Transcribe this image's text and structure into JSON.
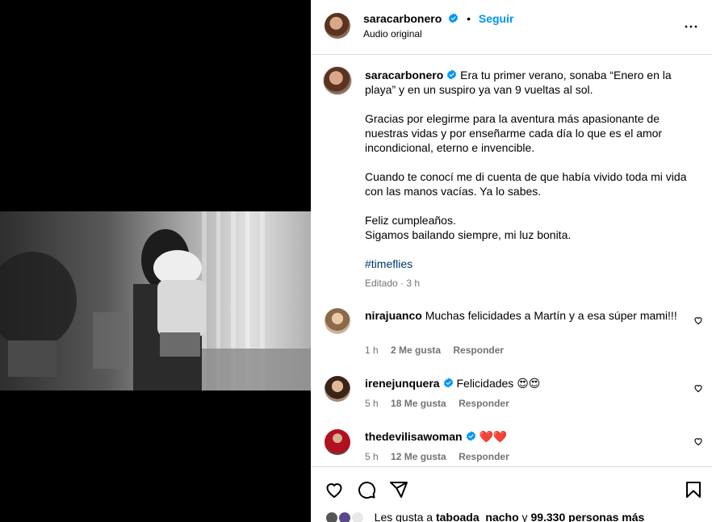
{
  "post": {
    "author": "saracarbonero",
    "follow_label": "Seguir",
    "dot": "•",
    "subtitle": "Audio original"
  },
  "caption": {
    "username": "saracarbonero",
    "paragraphs": [
      "Era tu primer verano, sonaba “Enero en la playa” y en un suspiro ya van 9 vueltas al sol.",
      "Gracias por elegirme para la aventura más apasionante de nuestras vidas y por enseñarme cada día lo que es el amor incondicional, eterno e invencible.",
      "Cuando te conocí me di cuenta de que había vivido toda mi vida con las manos vacías. Ya lo sabes.",
      "Feliz cumpleaños.",
      "Sigamos bailando siempre, mi luz bonita."
    ],
    "hashtag": "#timeflies",
    "edited": "Editado · 3 h"
  },
  "comments": [
    {
      "username": "nirajuanco",
      "text": "Muchas felicidades a Martín y a esa súper mami!!!",
      "time": "1 h",
      "likes": "2 Me gusta",
      "reply": "Responder"
    },
    {
      "username": "irenejunquera",
      "text": "Felicidades 😍😍",
      "time": "5 h",
      "likes": "18 Me gusta",
      "reply": "Responder"
    },
    {
      "username": "thedevilisawoman",
      "text": "❤️❤️",
      "time": "5 h",
      "likes": "12 Me gusta",
      "reply": "Responder"
    }
  ],
  "likes_line": {
    "prefix": "Les gusta a",
    "user1": "taboada_nacho",
    "connector": "y",
    "others": "99.330 personas más"
  },
  "icons": [
    "verified-badge-icon",
    "more-options-icon",
    "heart-icon",
    "comment-icon",
    "share-icon",
    "bookmark-icon"
  ],
  "colors": {
    "accent": "#0095f6",
    "hashtag": "#00376b",
    "muted": "#737373",
    "verified": "#0095f6"
  }
}
